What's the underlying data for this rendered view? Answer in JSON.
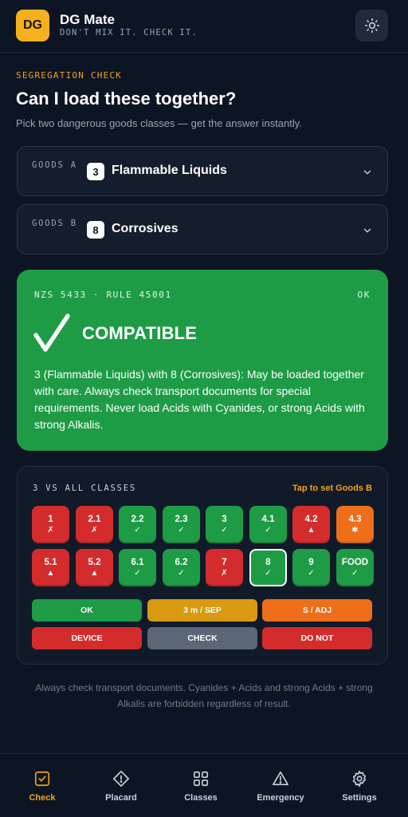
{
  "header": {
    "logo_text": "DG",
    "title": "DG Mate",
    "tagline": "DON'T MIX IT. CHECK IT.",
    "theme_icon": "sun-icon"
  },
  "intro": {
    "eyebrow": "SEGREGATION CHECK",
    "title": "Can I load these together?",
    "subtitle": "Pick two dangerous goods classes — get the answer instantly."
  },
  "goods_a": {
    "label": "GOODS A",
    "class_num": "3",
    "class_name": "Flammable Liquids"
  },
  "goods_b": {
    "label": "GOODS B",
    "class_num": "8",
    "class_name": "Corrosives"
  },
  "result": {
    "rule": "NZS 5433 · RULE 45001",
    "status": "OK",
    "verdict": "COMPATIBLE",
    "text": "3 (Flammable Liquids) with 8 (Corrosives): May be loaded together with care. Always check transport documents for special requirements. Never load Acids with Cyanides, or strong Acids with strong Alkalis.",
    "color": "#1e9c45"
  },
  "matrix": {
    "title": "3 VS ALL CLASSES",
    "hint": "Tap to set Goods B",
    "cells": [
      {
        "label": "1",
        "symbol": "✗",
        "status": "red"
      },
      {
        "label": "2.1",
        "symbol": "✗",
        "status": "red"
      },
      {
        "label": "2.2",
        "symbol": "✓",
        "status": "green"
      },
      {
        "label": "2.3",
        "symbol": "✓",
        "status": "green"
      },
      {
        "label": "3",
        "symbol": "✓",
        "status": "green"
      },
      {
        "label": "4.1",
        "symbol": "✓",
        "status": "green"
      },
      {
        "label": "4.2",
        "symbol": "▲",
        "status": "red"
      },
      {
        "label": "4.3",
        "symbol": "✱",
        "status": "orange"
      },
      {
        "label": "5.1",
        "symbol": "▲",
        "status": "red"
      },
      {
        "label": "5.2",
        "symbol": "▲",
        "status": "red"
      },
      {
        "label": "6.1",
        "symbol": "✓",
        "status": "green"
      },
      {
        "label": "6.2",
        "symbol": "✓",
        "status": "green"
      },
      {
        "label": "7",
        "symbol": "✗",
        "status": "red"
      },
      {
        "label": "8",
        "symbol": "✓",
        "status": "green",
        "selected": true
      },
      {
        "label": "9",
        "symbol": "✓",
        "status": "green"
      },
      {
        "label": "FOOD",
        "symbol": "✓",
        "status": "green"
      }
    ],
    "legend": [
      {
        "label": "OK",
        "color": "#1e9c45"
      },
      {
        "label": "3 m / SEP",
        "color": "#d99a12"
      },
      {
        "label": "S / ADJ",
        "color": "#ef6e1a"
      },
      {
        "label": "DEVICE",
        "color": "#d42c2c"
      },
      {
        "label": "CHECK",
        "color": "#5b6678"
      },
      {
        "label": "DO NOT",
        "color": "#d42c2c"
      }
    ]
  },
  "footnote": "Always check transport documents. Cyanides + Acids and strong Acids + strong Alkalis are forbidden regardless of result.",
  "tabs": [
    {
      "label": "Check",
      "icon": "check-square-icon",
      "active": true
    },
    {
      "label": "Placard",
      "icon": "placard-diamond-icon",
      "active": false
    },
    {
      "label": "Classes",
      "icon": "grid-icon",
      "active": false
    },
    {
      "label": "Emergency",
      "icon": "warning-triangle-icon",
      "active": false
    },
    {
      "label": "Settings",
      "icon": "gear-icon",
      "active": false
    }
  ]
}
